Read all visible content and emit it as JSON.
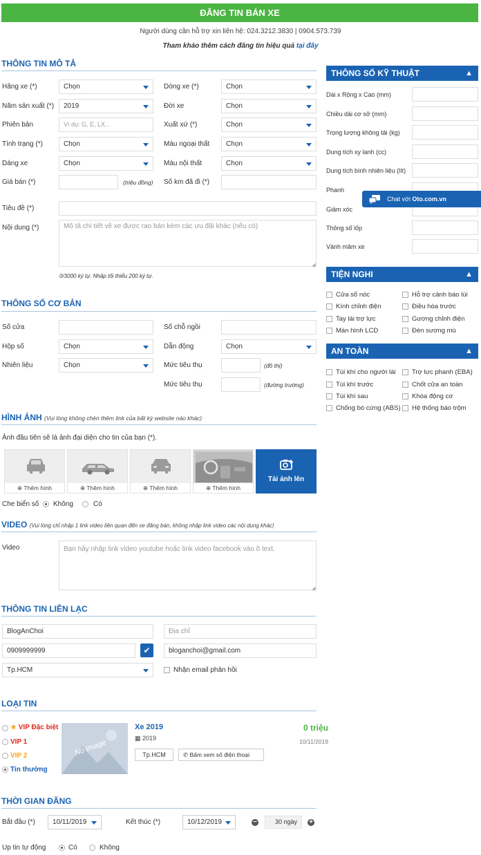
{
  "banner": "ĐĂNG TIN BÁN XE",
  "support": "Người dùng cần hỗ trợ xin liên hệ: 024.3212.3830 | 0904.573.739",
  "tip": {
    "text": "Tham khảo thêm cách đăng tin hiệu quả ",
    "link": "tại đây"
  },
  "desc": {
    "title": "THÔNG TIN MÔ TẢ",
    "hang_label": "Hãng xe (*)",
    "hang_val": "Chọn",
    "dong_label": "Dòng xe (*)",
    "dong_val": "Chọn",
    "nam_label": "Năm sản xuất (*)",
    "nam_val": "2019",
    "doi_label": "Đời xe",
    "doi_val": "Chọn",
    "phienban_label": "Phiên bản",
    "phienban_ph": "Ví dụ: G, E, LX..",
    "xuatxu_label": "Xuất xứ (*)",
    "xuatxu_val": "Chọn",
    "tinhtrang_label": "Tình trạng (*)",
    "tinhtrang_val": "Chọn",
    "maungoai_label": "Màu ngoại thất",
    "maungoai_val": "Chọn",
    "dang_label": "Dáng xe",
    "dang_val": "Chọn",
    "maunoi_label": "Màu nội thất",
    "maunoi_val": "Chọn",
    "gia_label": "Giá bán (*)",
    "gia_unit": "(triệu đồng)",
    "km_label": "Số km đã đi (*)",
    "tieude_label": "Tiêu đề (*)",
    "noidung_label": "Nội dung (*)",
    "noidung_ph": "Mô tả chi tiết về xe được rao bán kèm các ưu đãi khác (nếu có)",
    "counter": "0/3000 ký tự. Nhập tối thiểu 200 ký tự."
  },
  "basic": {
    "title": "THÔNG SỐ CƠ BẢN",
    "socua": "Số cửa",
    "socho": "Số chỗ ngồi",
    "hopso": "Hộp số",
    "hopso_val": "Chọn",
    "dandong": "Dẫn động",
    "dandong_val": "Chọn",
    "nhienlieu": "Nhiên liệu",
    "nhienlieu_val": "Chọn",
    "tieuthu": "Mức tiêu thụ",
    "dothi": "(đô thị)",
    "duongtruong": "(đường trường)"
  },
  "images": {
    "title": "HÌNH ẢNH",
    "note": "(Vui lòng không chèn thêm link của bất kỳ website nào khác)",
    "intro": "Ảnh đầu tiên sẽ là ảnh đại diện cho tin của bạn (*).",
    "add": "Thêm hình",
    "upload": "Tải ảnh lên",
    "plate_label": "Che biển số",
    "plate_no": "Không",
    "plate_yes": "Có"
  },
  "video": {
    "title": "VIDEO",
    "note": "(Vui lòng chỉ nhập 1 link video liên quan đến xe đăng bán, không nhập link video các nội dung khác)",
    "label": "Video",
    "ph": "Bạn hãy nhập link video youtube hoặc link video facebook vào ô text."
  },
  "contact": {
    "title": "THÔNG TIN LIÊN LẠC",
    "name": "BlogAnChoi",
    "address_ph": "Địa chỉ",
    "phone": "0909999999",
    "email": "bloganchoi@gmail.com",
    "city": "Tp.HCM",
    "notify": "Nhận email phản hồi"
  },
  "listing": {
    "title": "LOẠI TIN",
    "options": [
      "VIP Đặc biệt",
      "VIP 1",
      "VIP 2",
      "Tin thường"
    ],
    "star": "★",
    "noimage": "No Image",
    "car": "Xe 2019",
    "year": "2019",
    "price": "0 triệu",
    "date": "10/11/2019",
    "city": "Tp.HCM",
    "phone_btn": "Bấm xem số điện thoại"
  },
  "schedule": {
    "title": "THỜI GIAN ĐĂNG",
    "start_label": "Bắt đầu (*)",
    "start": "10/11/2019",
    "end_label": "Kết thúc (*)",
    "end": "10/12/2019",
    "days": "30 ngày",
    "auto_label": "Up tin tự động",
    "auto_yes": "Có",
    "auto_no": "Không"
  },
  "tech": {
    "title": "THÔNG SỐ KỸ THUẬT",
    "fields": [
      "Dài x Rộng x Cao (mm)",
      "Chiều dài cơ sở (mm)",
      "Trọng lượng không tải (kg)",
      "Dung tích xy lanh (cc)",
      "Dung tích bình nhiên liệu (lít)",
      "Phanh",
      "Giảm xóc",
      "Thông số lốp",
      "Vành mâm xe"
    ]
  },
  "comfort": {
    "title": "TIỆN NGHI",
    "items": [
      "Cửa sổ nóc",
      "Hỗ trợ cảnh báo lùi",
      "Kính chỉnh điện",
      "Điều hòa trước",
      "Tay lái trợ lực",
      "Gương chỉnh điện",
      "Màn hình LCD",
      "Đèn sương mù"
    ]
  },
  "safety": {
    "title": "AN TOÀN",
    "items": [
      "Túi khí cho người lái",
      "Trợ lực phanh (EBA)",
      "Túi khí trước",
      "Chốt cửa an toàn",
      "Túi khí sau",
      "Khóa động cơ",
      "Chống bó cứng (ABS)",
      "Hệ thống báo trộm"
    ]
  },
  "chat": {
    "prefix": "Chat với ",
    "brand": "Oto.com.vn"
  },
  "colors": {
    "green": "#4bb543",
    "blue": "#1a63b3",
    "red": "#e0261b",
    "orange": "#f5a623"
  }
}
